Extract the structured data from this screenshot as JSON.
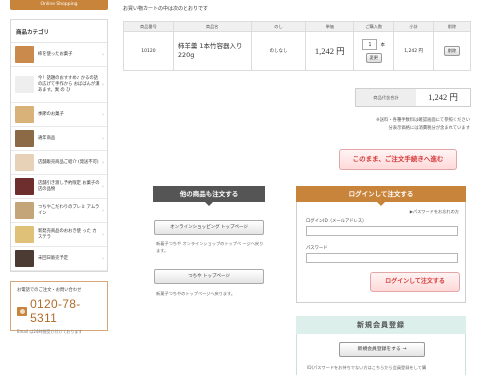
{
  "brand": {
    "tab_label": "Online Shopping"
  },
  "sidebar": {
    "category_title": "商品カテゴリ",
    "items": [
      {
        "label": "柿を使ったお菓子",
        "thumb_color": "#c98a4b"
      },
      {
        "label": "今！話題のおすすめ♪ かるの話の広げて手作から おばばんが漢あます。異 の ひ",
        "thumb_color": "#eeeeee"
      },
      {
        "label": "季節のお菓子",
        "thumb_color": "#d9b27a"
      },
      {
        "label": "通年商品",
        "thumb_color": "#8c6a45"
      },
      {
        "label": "店舗販売商品ご紹介 (発送不可)",
        "thumb_color": "#e7d2b8"
      },
      {
        "label": "店舗引き渡し予約限定 お菓子の 店の品物",
        "thumb_color": "#6f2e2e"
      },
      {
        "label": "つちやこだわりのプレミ アムライン",
        "thumb_color": "#c4a57a"
      },
      {
        "label": "新発売商品のおおき使 った カステラ",
        "thumb_color": "#dfc277"
      },
      {
        "label": "未回日販売予定",
        "thumb_color": "#4b3b32"
      }
    ],
    "contact": {
      "lead": "お電話でのご注文・お問い合わせ",
      "phone": "0120-78-5311",
      "note": "Email は24時間受け付けております"
    }
  },
  "main": {
    "intro": "お買い物カートの中は次のとおりです",
    "table": {
      "headers": [
        "商品番号",
        "商品名",
        "のし",
        "単価",
        "ご購入数",
        "小計",
        "削除"
      ],
      "row": {
        "code": "10120",
        "name": "柿羊羹 1本竹容器入り 220g",
        "noshi": "のしなし",
        "price": "1,242 円",
        "qty": "1",
        "qty_unit": "本",
        "change_label": "変更",
        "subtotal": "1,242 円",
        "delete_label": "削除"
      }
    },
    "total": {
      "label": "商品代金合計",
      "value": "1,242 円"
    },
    "notes": [
      "※送料・各種手数料は確認画面にて参照ください",
      "分表示価格には消費税分が含まれています"
    ],
    "checkout_label": "このまま、ご注文手続きへ進む"
  },
  "other_shop": {
    "title": "他の商品も注文する",
    "online_btn": "オンラインショッピング トップページ",
    "online_desc": "新着子つちや オンラインショップのトップペ ージへ戻ります。",
    "top_btn": "つちや トップページ",
    "top_desc": "新菓子つちやのトップページへ戻ります。"
  },
  "login": {
    "title": "ログインして注文する",
    "forgot": "▶パスワードをお忘れの方",
    "id_label": "ログインID（メールアドレス）",
    "pw_label": "パスワード",
    "btn": "ログインして注文する"
  },
  "register": {
    "title": "新規会員登録",
    "btn": "新規会員登録をする →",
    "desc": "ID(パスワードをお持ちでない方はこちらから会員登録をして購"
  }
}
